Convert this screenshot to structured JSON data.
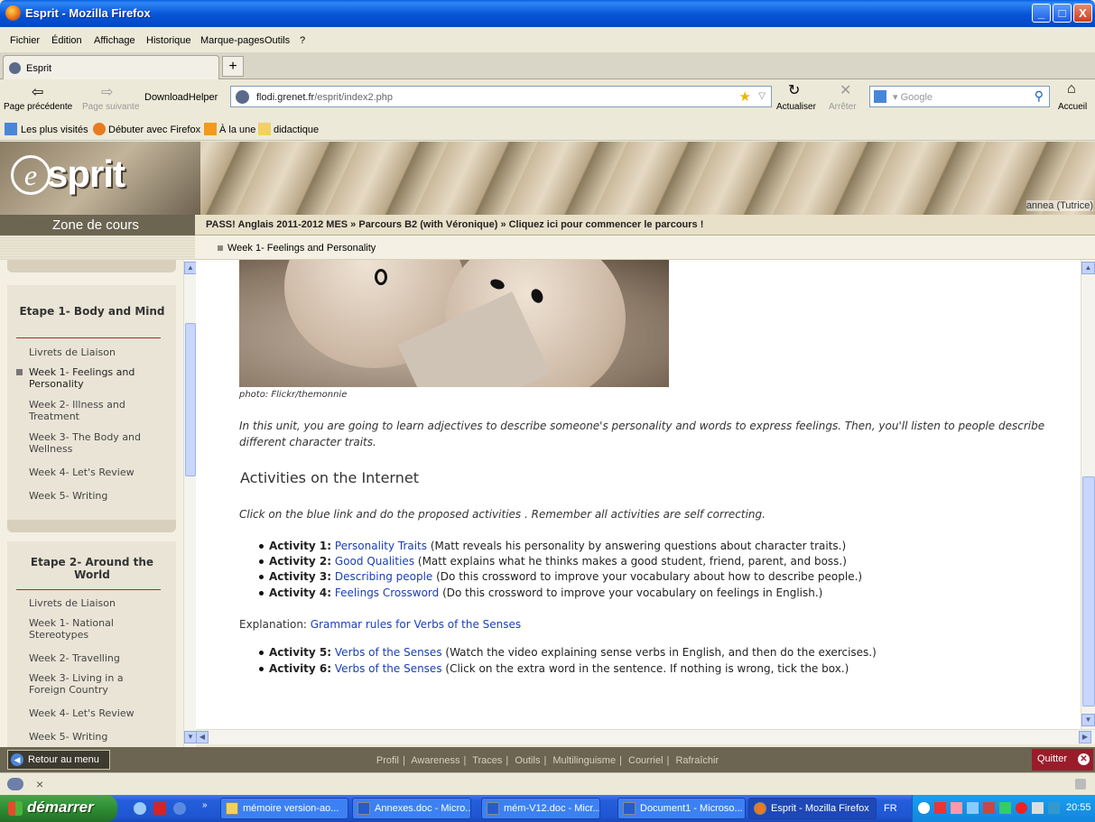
{
  "window": {
    "title": "Esprit - Mozilla Firefox",
    "min": "_",
    "max": "□",
    "close": "X"
  },
  "menu": [
    "Fichier",
    "Édition",
    "Affichage",
    "Historique",
    "Marque-pages",
    "Outils",
    "?"
  ],
  "tab": {
    "label": "Esprit",
    "new": "+"
  },
  "nav": {
    "back_label": "Page précédente",
    "forward_label": "Page suivante",
    "downloadhelper": "DownloadHelper",
    "url_domain": "flodi.grenet.fr",
    "url_path": "/esprit/index2.php",
    "reload_label": "Actualiser",
    "stop_label": "Arrêter",
    "search_placeholder": "Google",
    "home_label": "Accueil"
  },
  "bookmarks": [
    "Les plus visités",
    "Débuter avec Firefox",
    "À la une",
    "didactique"
  ],
  "banner": {
    "user": "annea (Tutrice)",
    "logo_letter": "e",
    "logo_word": "sprit"
  },
  "zone_label": "Zone de cours",
  "breadcrumb": "PASS! Anglais 2011-2012 MES » Parcours B2 (with Véronique) » Cliquez ici pour commencer le parcours !",
  "current_section": "Week 1- Feelings and Personality",
  "sidebar": {
    "stage1": {
      "title": "Etape 1- Body and Mind",
      "items": [
        "Livrets de Liaison",
        "Week 1- Feelings and Personality",
        "Week 2- Illness and Treatment",
        "Week 3- The Body and Wellness",
        "Week 4- Let's Review",
        "Week 5- Writing"
      ]
    },
    "stage2": {
      "title": "Etape 2- Around the World",
      "items": [
        "Livrets de Liaison",
        "Week 1- National Stereotypes",
        "Week 2- Travelling",
        "Week 3- Living in a Foreign Country",
        "Week 4- Let's Review",
        "Week 5- Writing"
      ]
    }
  },
  "content": {
    "caption": "photo: Flickr/themonnie",
    "intro": "In this unit, you are going to learn adjectives to describe someone's personality and words to express feelings. Then, you'll listen to people describe different character traits.",
    "heading": "Activities on the Internet",
    "instruction": "Click on the blue link and do the proposed activities . Remember all activities are self correcting.",
    "activities": [
      {
        "label": "Activity 1:",
        "link": "Personality Traits",
        "text": " (Matt reveals his personality by answering questions about character traits.)"
      },
      {
        "label": "Activity 2:",
        "link": "Good Qualities",
        "text": " (Matt explains what he thinks makes a good student, friend, parent, and boss.)"
      },
      {
        "label": "Activity 3:",
        "link": " Describing people",
        "text": " (Do this crossword to improve your vocabulary about how to describe people.)"
      },
      {
        "label": "Activity 4:",
        "link": "Feelings Crossword",
        "text": " (Do this crossword to improve your vocabulary on feelings in English.)"
      }
    ],
    "explanation_label": "Explanation: ",
    "explanation_link": "Grammar rules for Verbs of the Senses",
    "activities2": [
      {
        "label": "Activity 5:",
        "link": "Verbs of the Senses",
        "text": " (Watch the video explaining sense verbs in English, and then do the exercises.)"
      },
      {
        "label": "Activity 6:",
        "link": "Verbs of the Senses",
        "text": " (Click on the extra word in the sentence. If nothing is wrong, tick the box.)"
      }
    ]
  },
  "bottom": {
    "retour": "Retour au menu",
    "menu": [
      "Profil",
      "Awareness",
      "Traces",
      "Outils",
      "Multilinguisme",
      "Courriel",
      "Rafraîchir"
    ],
    "quitter": "Quitter"
  },
  "statusbar": {
    "close": "×"
  },
  "taskbar": {
    "start": "démarrer",
    "items": [
      "mémoire version-ao...",
      "Annexes.doc - Micro...",
      "mém-V12.doc - Micr...",
      "Document1 - Microso...",
      "Esprit - Mozilla Firefox"
    ],
    "lang": "FR",
    "clock": "20:55"
  },
  "colors": {
    "link": "#1a40b8",
    "course_bar": "#6b6552",
    "stage_rule": "#b0282f",
    "quit": "#9a1c2a"
  }
}
